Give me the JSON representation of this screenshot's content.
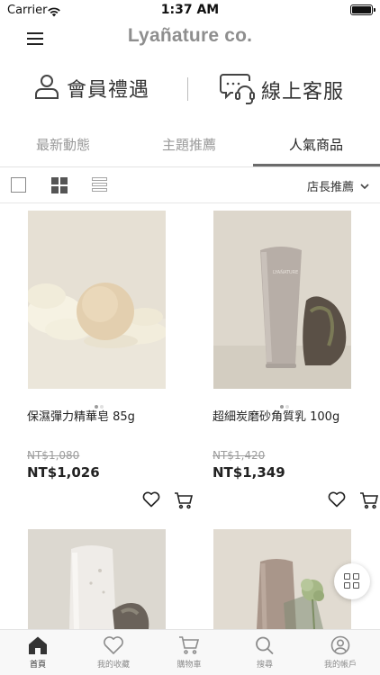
{
  "status_bar": {
    "carrier": "Carrier",
    "time": "1:37 AM"
  },
  "header": {
    "brand": "Lyañature co.",
    "menu_icon": "hamburger-menu-icon"
  },
  "quick_links": [
    {
      "label": "會員禮遇",
      "icon": "user-icon"
    },
    {
      "label": "線上客服",
      "icon": "chat-support-icon"
    }
  ],
  "tabs": [
    {
      "label": "最新動態",
      "active": false
    },
    {
      "label": "主題推薦",
      "active": false
    },
    {
      "label": "人氣商品",
      "active": true
    }
  ],
  "toolbar": {
    "sort_label": "店長推薦",
    "active_view": "grid"
  },
  "products": [
    {
      "name": "保濕彈力精華皂 85g",
      "original_price": "NT$1,080",
      "price": "NT$1,026"
    },
    {
      "name": "超細炭磨砂角質乳 100g",
      "original_price": "NT$1,420",
      "price": "NT$1,349"
    },
    {
      "name": "",
      "original_price": "",
      "price": ""
    },
    {
      "name": "",
      "original_price": "",
      "price": ""
    }
  ],
  "bottom_nav": [
    {
      "label": "首頁",
      "icon": "home-icon",
      "active": true
    },
    {
      "label": "我的收藏",
      "icon": "heart-icon",
      "active": false
    },
    {
      "label": "購物車",
      "icon": "cart-icon",
      "active": false
    },
    {
      "label": "搜尋",
      "icon": "search-icon",
      "active": false
    },
    {
      "label": "我的帳戶",
      "icon": "account-icon",
      "active": false
    }
  ],
  "colors": {
    "brand": "#8e8e8e",
    "accent_underline": "#6b6b6b",
    "muted_text": "#9a9a9a"
  }
}
